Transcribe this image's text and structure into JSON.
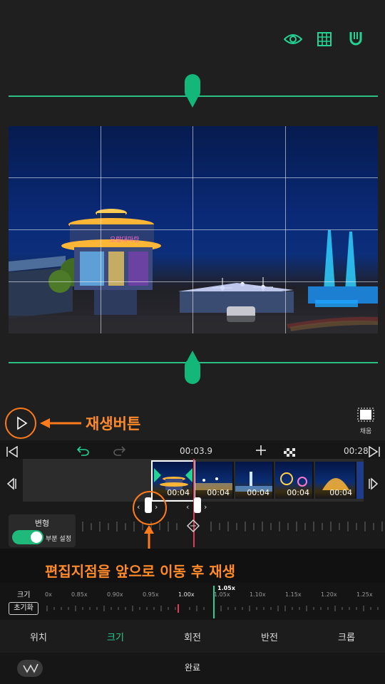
{
  "colors": {
    "accent": "#23d394",
    "annotation": "#ff7a1a",
    "playhead": "#e23a5c"
  },
  "top_icons": [
    "eye-icon",
    "grid-icon",
    "magnet-icon"
  ],
  "fill_label": "채움",
  "annotations": {
    "play_label": "재생버튼",
    "move_label": "편집지점을 앞으로 이동 후 재생"
  },
  "timeline": {
    "current_time": "00:03.9",
    "total_time": "00:28",
    "clips": [
      {
        "duration": "00:04"
      },
      {
        "duration": "00:04"
      },
      {
        "duration": "00:04"
      },
      {
        "duration": "00:04"
      },
      {
        "duration": "00:04"
      }
    ]
  },
  "transform": {
    "label": "변형",
    "partial_label": "부분 설정",
    "partial_enabled": true
  },
  "size": {
    "label": "크기",
    "reset_label": "초기화",
    "current_value": "1.05x",
    "ticks": [
      "0x",
      "0.85x",
      "0.90x",
      "0.95x",
      "1.00x",
      "1.05x",
      "1.10x",
      "1.15x",
      "1.20x",
      "1.25x"
    ]
  },
  "tabs": [
    {
      "label": "위치",
      "active": false
    },
    {
      "label": "크기",
      "active": true
    },
    {
      "label": "회전",
      "active": false
    },
    {
      "label": "반전",
      "active": false
    },
    {
      "label": "크롭",
      "active": false
    }
  ],
  "done_label": "완료"
}
